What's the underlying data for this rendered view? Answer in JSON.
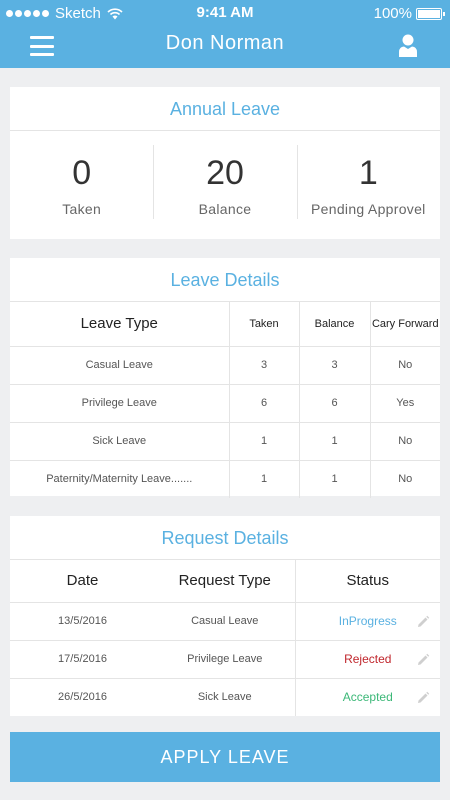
{
  "status_bar": {
    "carrier": "Sketch",
    "time": "9:41 AM",
    "battery": "100%",
    "battery_level": 1.0
  },
  "header": {
    "title": "Don Norman"
  },
  "annual_leave": {
    "title": "Annual Leave",
    "stats": [
      {
        "value": "0",
        "label": "Taken"
      },
      {
        "value": "20",
        "label": "Balance"
      },
      {
        "value": "1",
        "label": "Pending Approvel"
      }
    ]
  },
  "leave_details": {
    "title": "Leave Details",
    "headers": [
      "Leave Type",
      "Taken",
      "Balance",
      "Cary Forward"
    ],
    "rows": [
      [
        "Casual Leave",
        "3",
        "3",
        "No"
      ],
      [
        "Privilege Leave",
        "6",
        "6",
        "Yes"
      ],
      [
        "Sick Leave",
        "1",
        "1",
        "No"
      ],
      [
        "Paternity/Maternity Leave.......",
        "1",
        "1",
        "No"
      ]
    ]
  },
  "request_details": {
    "title": "Request Details",
    "headers": [
      "Date",
      "Request Type",
      "Status"
    ],
    "rows": [
      {
        "date": "13/5/2016",
        "type": "Casual Leave",
        "status": "InProgress",
        "status_color": "#5ab1e1"
      },
      {
        "date": "17/5/2016",
        "type": "Privilege Leave",
        "status": "Rejected",
        "status_color": "#c0262c"
      },
      {
        "date": "26/5/2016",
        "type": "Sick Leave",
        "status": "Accepted",
        "status_color": "#3cb878"
      }
    ]
  },
  "apply_button": {
    "label": "APPLY LEAVE"
  },
  "colors": {
    "accent": "#5ab1e1",
    "background": "#eeeff1"
  },
  "icons": [
    "menu-icon",
    "user-icon",
    "wifi-icon",
    "battery-icon",
    "edit-icon"
  ]
}
